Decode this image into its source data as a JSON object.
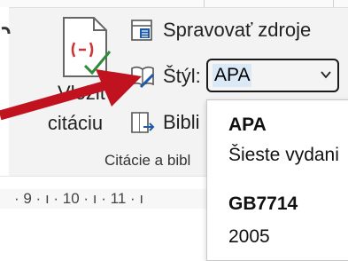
{
  "ribbon": {
    "insert_citation": {
      "line1": "Vložiť",
      "line2": "citáciu"
    },
    "manage_sources": "Spravovať zdroje",
    "style_label": "Štýl:",
    "style_value": "APA",
    "bibliography": "Bibli",
    "group_label": "Citácie a bibl"
  },
  "ruler": {
    "text": "· 9 · ı · 10 · ı · 11 · ı"
  },
  "style_dropdown": {
    "items": [
      {
        "name": "APA",
        "detail": "Šieste vydani"
      },
      {
        "name": "GB7714",
        "detail": "2005"
      }
    ]
  },
  "colors": {
    "arrow": "#c1121f",
    "accent_blue": "#1e5aa8",
    "citation_icon_red": "#d13438",
    "citation_icon_green": "#2e8b3a"
  },
  "icons": {
    "insert_citation": "document-check-icon",
    "manage_sources": "table-edit-icon",
    "style": "book-pencil-icon",
    "bibliography": "book-arrow-icon",
    "dropdown": "chevron-down-icon"
  }
}
